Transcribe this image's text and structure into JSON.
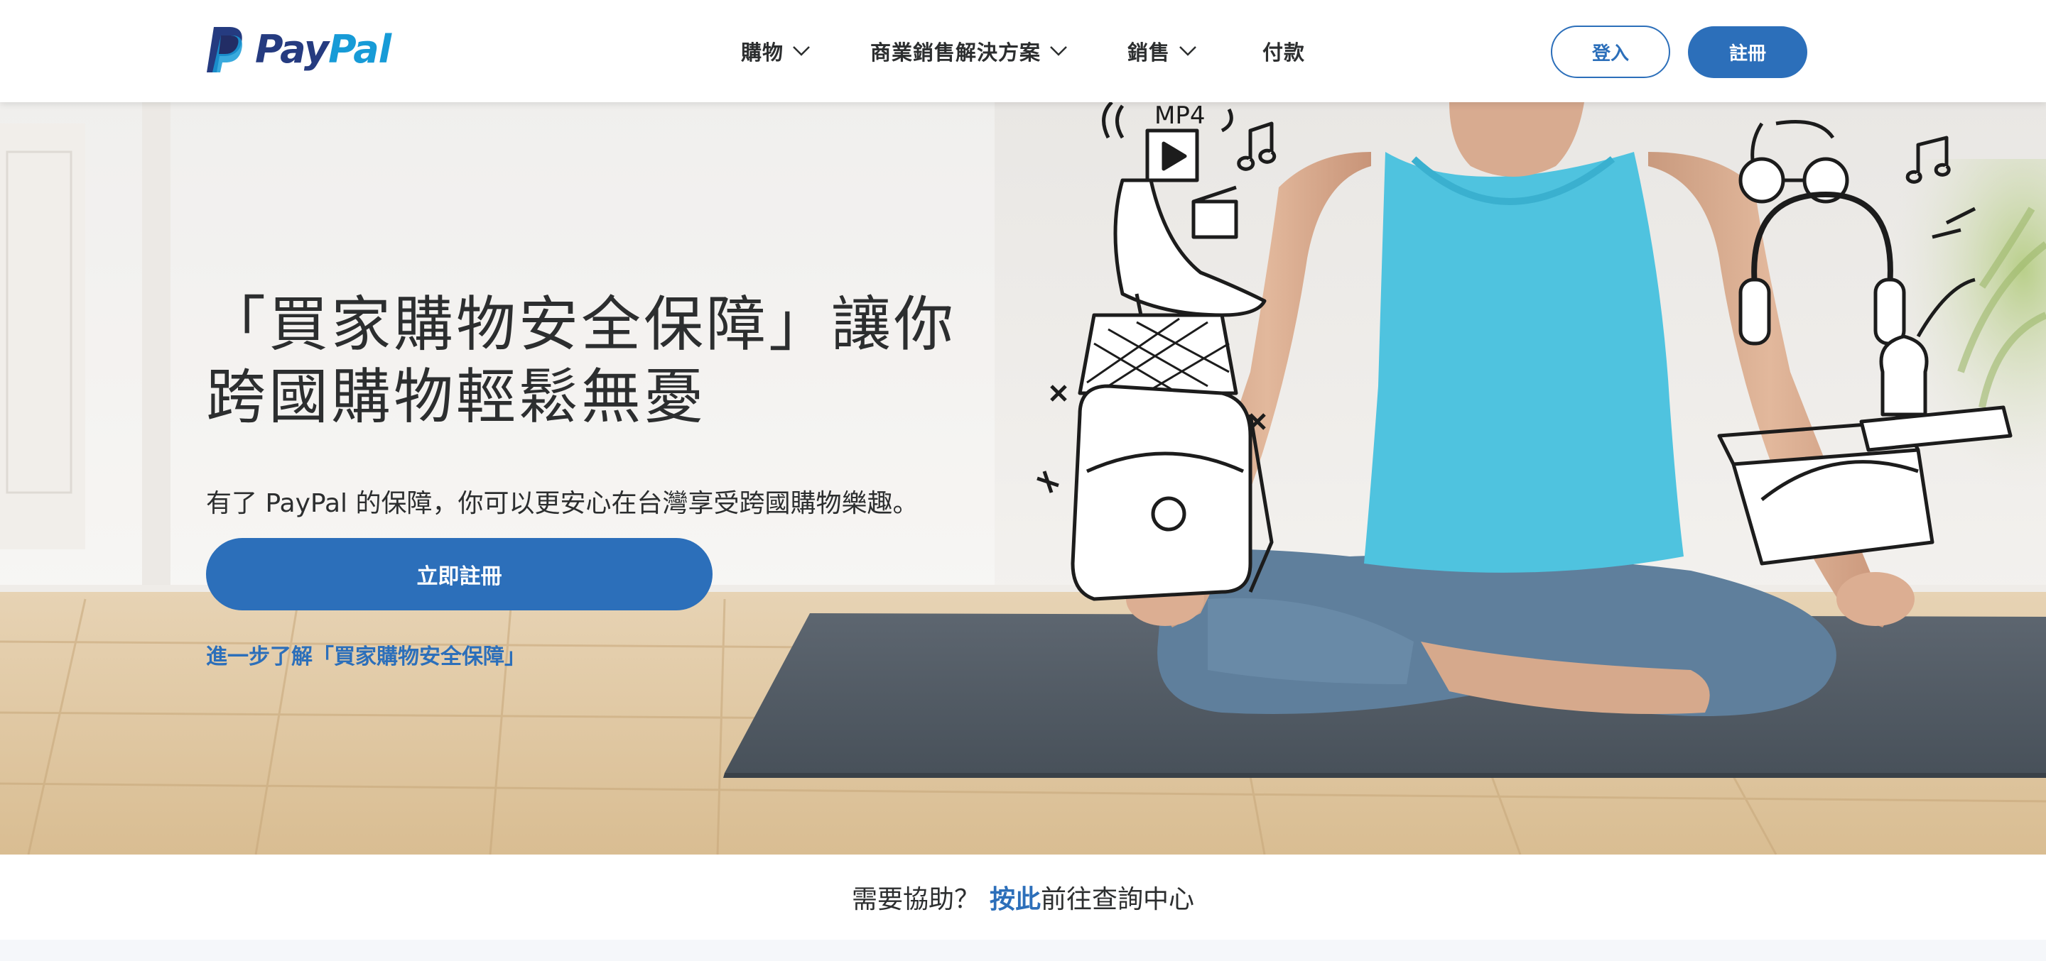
{
  "brand": {
    "logo_pay": "Pay",
    "logo_pal": "Pal",
    "primary_color": "#2c6fba",
    "logo_dark": "#253b80",
    "logo_light": "#179bd7"
  },
  "header": {
    "nav": [
      {
        "label": "購物",
        "has_dropdown": true,
        "icon": "chevron-down-icon"
      },
      {
        "label": "商業銷售解決方案",
        "has_dropdown": true,
        "icon": "chevron-down-icon"
      },
      {
        "label": "銷售",
        "has_dropdown": true,
        "icon": "chevron-down-icon"
      },
      {
        "label": "付款",
        "has_dropdown": false
      }
    ],
    "login_label": "登入",
    "signup_label": "註冊"
  },
  "hero": {
    "title": "「買家購物安全保障」讓你跨國購物輕鬆無憂",
    "subtitle": "有了 PayPal 的保障，你可以更安心在台灣享受跨國購物樂趣。",
    "cta_label": "立即註冊",
    "learn_more_link": "進一步了解「買家購物安全保障」",
    "overlay_text": "MP4"
  },
  "help_bar": {
    "prefix": "需要協助？",
    "link_label": "按此",
    "suffix": "前往查詢中心"
  }
}
